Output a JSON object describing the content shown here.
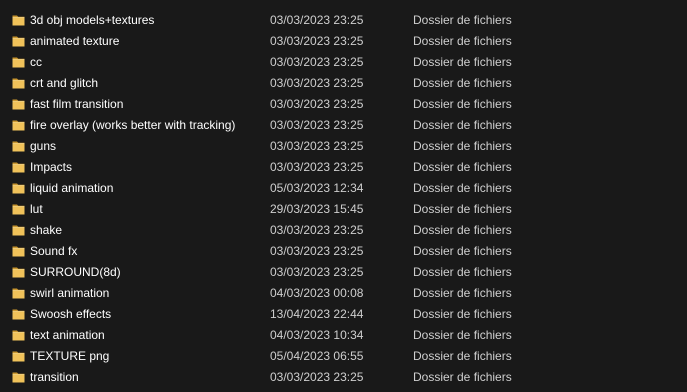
{
  "colors": {
    "background": "#191919",
    "text": "#ffffff",
    "subtext": "#cfcfcf",
    "folder": "#e8b84a"
  },
  "files": [
    {
      "name": "3d obj models+textures",
      "date": "03/03/2023 23:25",
      "type": "Dossier de fichiers",
      "icon": "folder-icon"
    },
    {
      "name": "animated texture",
      "date": "03/03/2023 23:25",
      "type": "Dossier de fichiers",
      "icon": "folder-icon"
    },
    {
      "name": "cc",
      "date": "03/03/2023 23:25",
      "type": "Dossier de fichiers",
      "icon": "folder-icon"
    },
    {
      "name": "crt and glitch",
      "date": "03/03/2023 23:25",
      "type": "Dossier de fichiers",
      "icon": "folder-icon"
    },
    {
      "name": "fast film transition",
      "date": "03/03/2023 23:25",
      "type": "Dossier de fichiers",
      "icon": "folder-icon"
    },
    {
      "name": "fire overlay (works better with tracking)",
      "date": "03/03/2023 23:25",
      "type": "Dossier de fichiers",
      "icon": "folder-icon"
    },
    {
      "name": "guns",
      "date": "03/03/2023 23:25",
      "type": "Dossier de fichiers",
      "icon": "folder-icon"
    },
    {
      "name": "Impacts",
      "date": "03/03/2023 23:25",
      "type": "Dossier de fichiers",
      "icon": "folder-icon"
    },
    {
      "name": "liquid animation",
      "date": "05/03/2023 12:34",
      "type": "Dossier de fichiers",
      "icon": "folder-icon"
    },
    {
      "name": "lut",
      "date": "29/03/2023 15:45",
      "type": "Dossier de fichiers",
      "icon": "folder-icon"
    },
    {
      "name": "shake",
      "date": "03/03/2023 23:25",
      "type": "Dossier de fichiers",
      "icon": "folder-icon"
    },
    {
      "name": "Sound fx",
      "date": "03/03/2023 23:25",
      "type": "Dossier de fichiers",
      "icon": "folder-icon"
    },
    {
      "name": "SURROUND(8d)",
      "date": "03/03/2023 23:25",
      "type": "Dossier de fichiers",
      "icon": "folder-icon"
    },
    {
      "name": "swirl animation",
      "date": "04/03/2023 00:08",
      "type": "Dossier de fichiers",
      "icon": "folder-icon"
    },
    {
      "name": "Swoosh effects",
      "date": "13/04/2023 22:44",
      "type": "Dossier de fichiers",
      "icon": "folder-icon"
    },
    {
      "name": "text animation",
      "date": "04/03/2023 10:34",
      "type": "Dossier de fichiers",
      "icon": "folder-icon"
    },
    {
      "name": "TEXTURE png",
      "date": "05/04/2023 06:55",
      "type": "Dossier de fichiers",
      "icon": "folder-icon"
    },
    {
      "name": "transition",
      "date": "03/03/2023 23:25",
      "type": "Dossier de fichiers",
      "icon": "folder-icon"
    }
  ]
}
